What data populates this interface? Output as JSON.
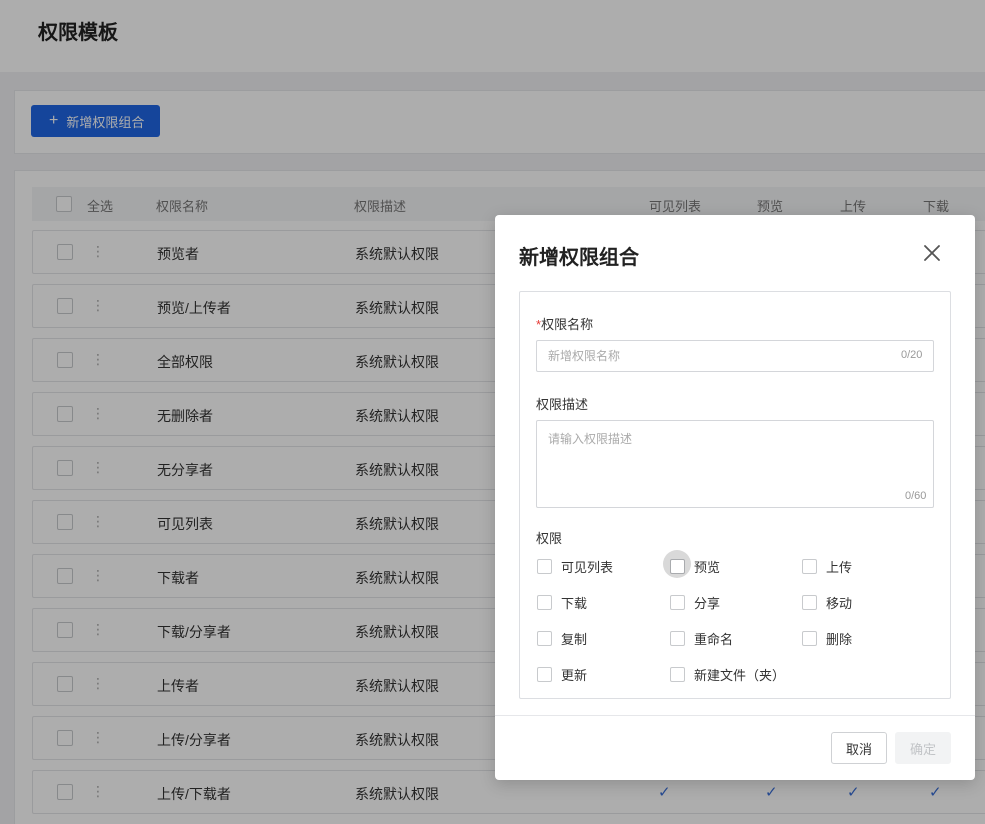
{
  "page": {
    "title": "权限模板"
  },
  "toolbar": {
    "add_icon": "+",
    "add_label": "新增权限组合"
  },
  "table": {
    "select_all": "全选",
    "columns": {
      "name": "权限名称",
      "desc": "权限描述",
      "visible": "可见列表",
      "preview": "预览",
      "upload": "上传",
      "download": "下载"
    },
    "rows": [
      {
        "name": "预览者",
        "desc": "系统默认权限"
      },
      {
        "name": "预览/上传者",
        "desc": "系统默认权限"
      },
      {
        "name": "全部权限",
        "desc": "系统默认权限"
      },
      {
        "name": "无删除者",
        "desc": "系统默认权限"
      },
      {
        "name": "无分享者",
        "desc": "系统默认权限"
      },
      {
        "name": "可见列表",
        "desc": "系统默认权限"
      },
      {
        "name": "下载者",
        "desc": "系统默认权限"
      },
      {
        "name": "下载/分享者",
        "desc": "系统默认权限"
      },
      {
        "name": "上传者",
        "desc": "系统默认权限"
      },
      {
        "name": "上传/分享者",
        "desc": "系统默认权限"
      },
      {
        "name": "上传/下载者",
        "desc": "系统默认权限"
      }
    ],
    "check_glyph": "✓",
    "more_glyph": "⋮"
  },
  "modal": {
    "title": "新增权限组合",
    "close_icon": "close-icon",
    "name_required_mark": "*",
    "name_label": "权限名称",
    "name_placeholder": "新增权限名称",
    "name_value": "",
    "name_counter": "0/20",
    "desc_label": "权限描述",
    "desc_placeholder": "请输入权限描述",
    "desc_value": "",
    "desc_counter": "0/60",
    "perm_label": "权限",
    "permissions": [
      "可见列表",
      "预览",
      "上传",
      "下载",
      "分享",
      "移动",
      "复制",
      "重命名",
      "删除",
      "更新",
      "新建文件（夹）"
    ],
    "cancel_label": "取消",
    "ok_label": "确定"
  },
  "colors": {
    "primary": "#1f66e5",
    "required": "#e53935",
    "check": "#3a6fd8",
    "overlay": "rgba(0,0,0,0.32)"
  }
}
